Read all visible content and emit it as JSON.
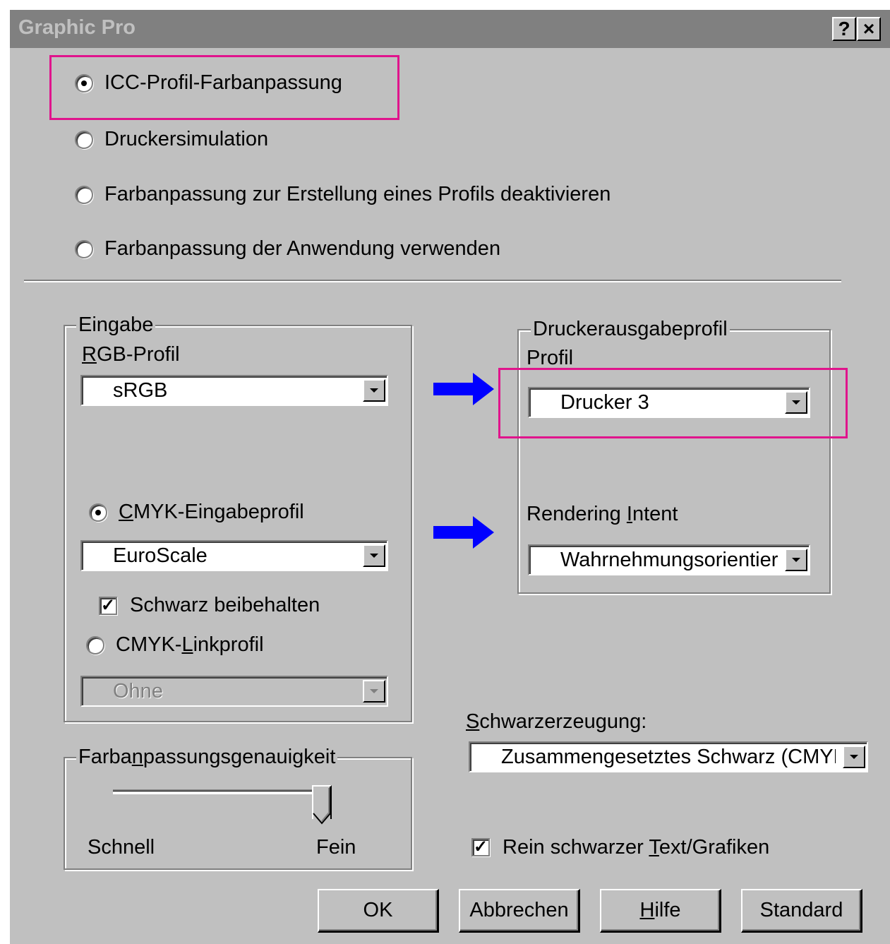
{
  "window": {
    "title": "Graphic Pro",
    "help_glyph": "?",
    "close_glyph": "×"
  },
  "mode_options": [
    {
      "label": "ICC-Profil-Farbanpassung",
      "selected": true
    },
    {
      "label": "Druckersimulation",
      "selected": false
    },
    {
      "label": "Farbanpassung zur Erstellung eines Profils deaktivieren",
      "selected": false
    },
    {
      "label": "Farbanpassung der Anwendung verwenden",
      "selected": false
    }
  ],
  "eingabe": {
    "group_title": "Eingabe",
    "rgb_label_accel": "R",
    "rgb_label_rest": "GB-Profil",
    "rgb_value": "sRGB",
    "cmyk_input_accel": "C",
    "cmyk_input_rest": "MYK-Eingabeprofil",
    "cmyk_input_selected": true,
    "cmyk_input_value": "EuroScale",
    "keep_black_label": "Schwarz beibehalten",
    "keep_black_checked": true,
    "cmyk_link_pre": "CMYK-",
    "cmyk_link_accel": "L",
    "cmyk_link_rest": "inkprofil",
    "cmyk_link_selected": false,
    "cmyk_link_value": "Ohne"
  },
  "druckerausgabe": {
    "group_title": "Druckerausgabeprofil",
    "profile_label": "Profil",
    "profile_value": "Drucker 3",
    "intent_label_pre": "Rendering ",
    "intent_label_accel": "I",
    "intent_label_rest": "ntent",
    "intent_value": "Wahrnehmungsorientier"
  },
  "accuracy": {
    "group_title_pre": "Farba",
    "group_title_accel": "n",
    "group_title_rest": "passungsgenauigkeit",
    "min_label": "Schnell",
    "max_label": "Fein",
    "level": 1.0
  },
  "black_generation": {
    "label_accel": "S",
    "label_rest": "chwarzerzeugung:",
    "value": "Zusammengesetztes Schwarz (CMYK"
  },
  "pure_black": {
    "label_pre": "Rein schwarzer ",
    "label_accel": "T",
    "label_rest": "ext/Grafiken",
    "checked": true
  },
  "buttons": {
    "ok": "OK",
    "cancel": "Abbrechen",
    "help_accel": "H",
    "help_rest": "ilfe",
    "default": "Standard"
  },
  "colors": {
    "highlight": "#e0148c",
    "arrow": "#0000ff",
    "face": "#c0c0c0",
    "titlebar": "#808080"
  }
}
